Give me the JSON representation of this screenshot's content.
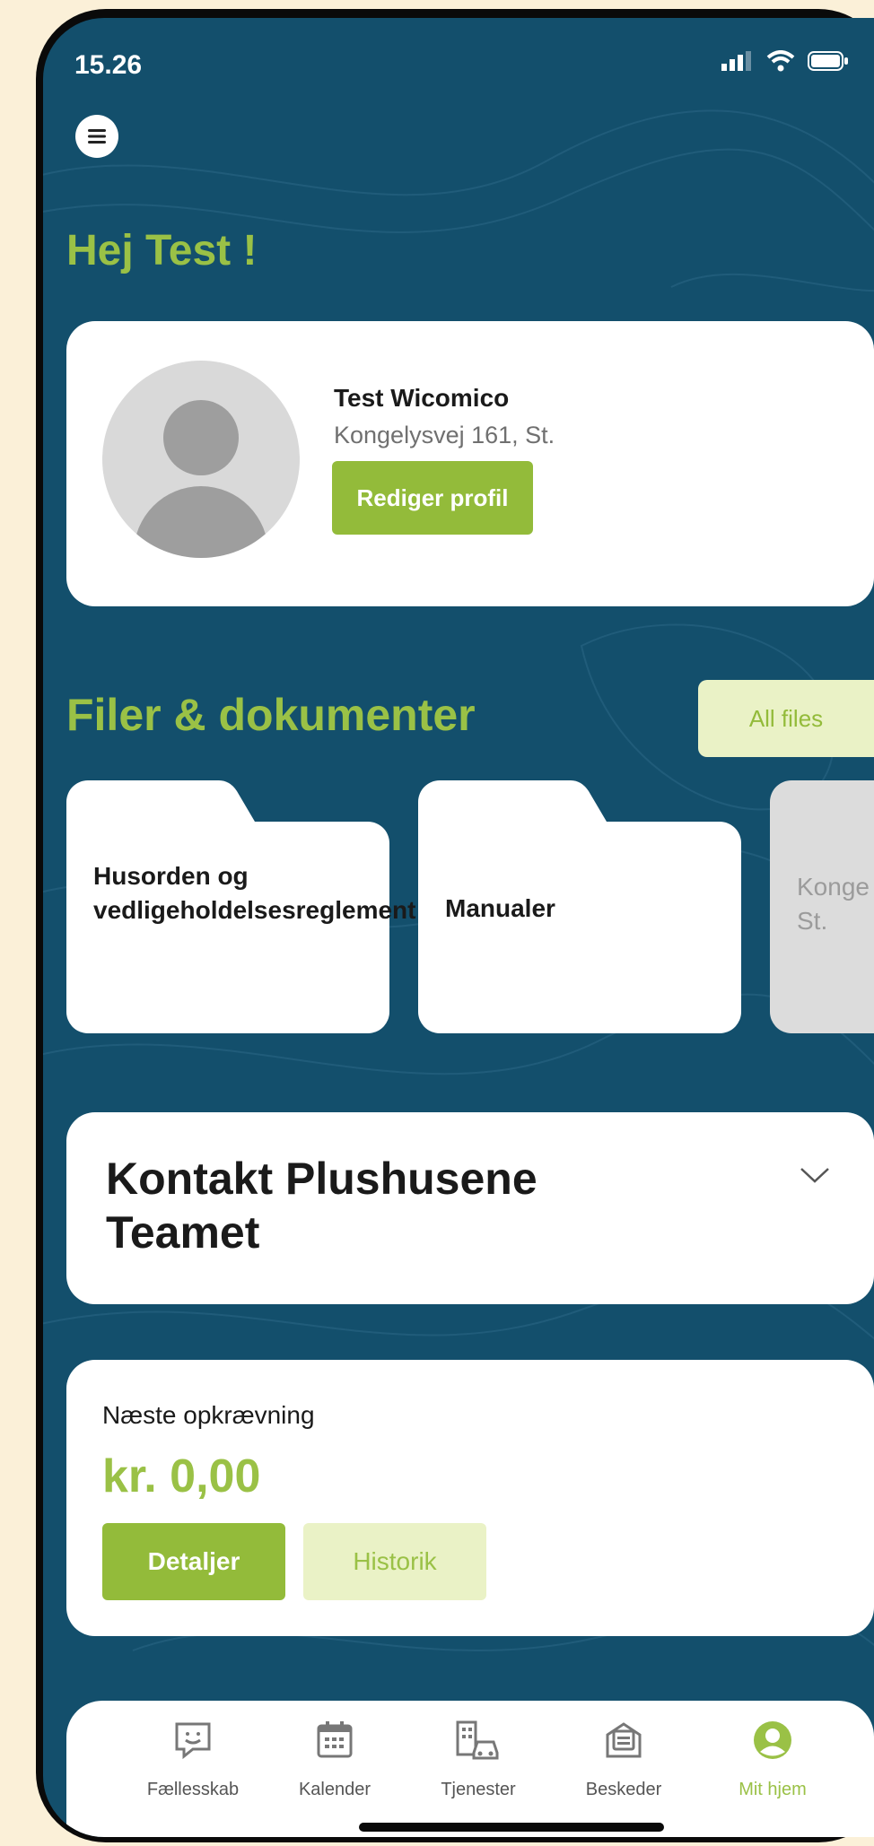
{
  "status_bar": {
    "time": "15.26"
  },
  "greeting": "Hej Test !",
  "profile": {
    "name": "Test Wicomico",
    "address": "Kongelysvej 161, St.",
    "edit_button": "Rediger profil"
  },
  "files": {
    "title": "Filer & dokumenter",
    "all_files_button": "All files",
    "folders": [
      {
        "label": "Husorden og vedligeholdelsesreglement"
      },
      {
        "label": "Manualer"
      },
      {
        "label": "Konge St."
      }
    ]
  },
  "contact": {
    "title": "Kontakt Plushusene Teamet"
  },
  "billing": {
    "label": "Næste opkrævning",
    "amount": "kr. 0,00",
    "details_button": "Detaljer",
    "history_button": "Historik"
  },
  "tabbar": {
    "items": [
      {
        "label": "Fællesskab",
        "icon": "chat-smile-icon"
      },
      {
        "label": "Kalender",
        "icon": "calendar-icon"
      },
      {
        "label": "Tjenester",
        "icon": "building-car-icon"
      },
      {
        "label": "Beskeder",
        "icon": "message-icon"
      },
      {
        "label": "Mit hjem",
        "icon": "user-circle-icon",
        "active": true
      }
    ]
  },
  "colors": {
    "background": "#134f6c",
    "accent": "#9ac146",
    "accent_light": "#eaf2c6"
  }
}
